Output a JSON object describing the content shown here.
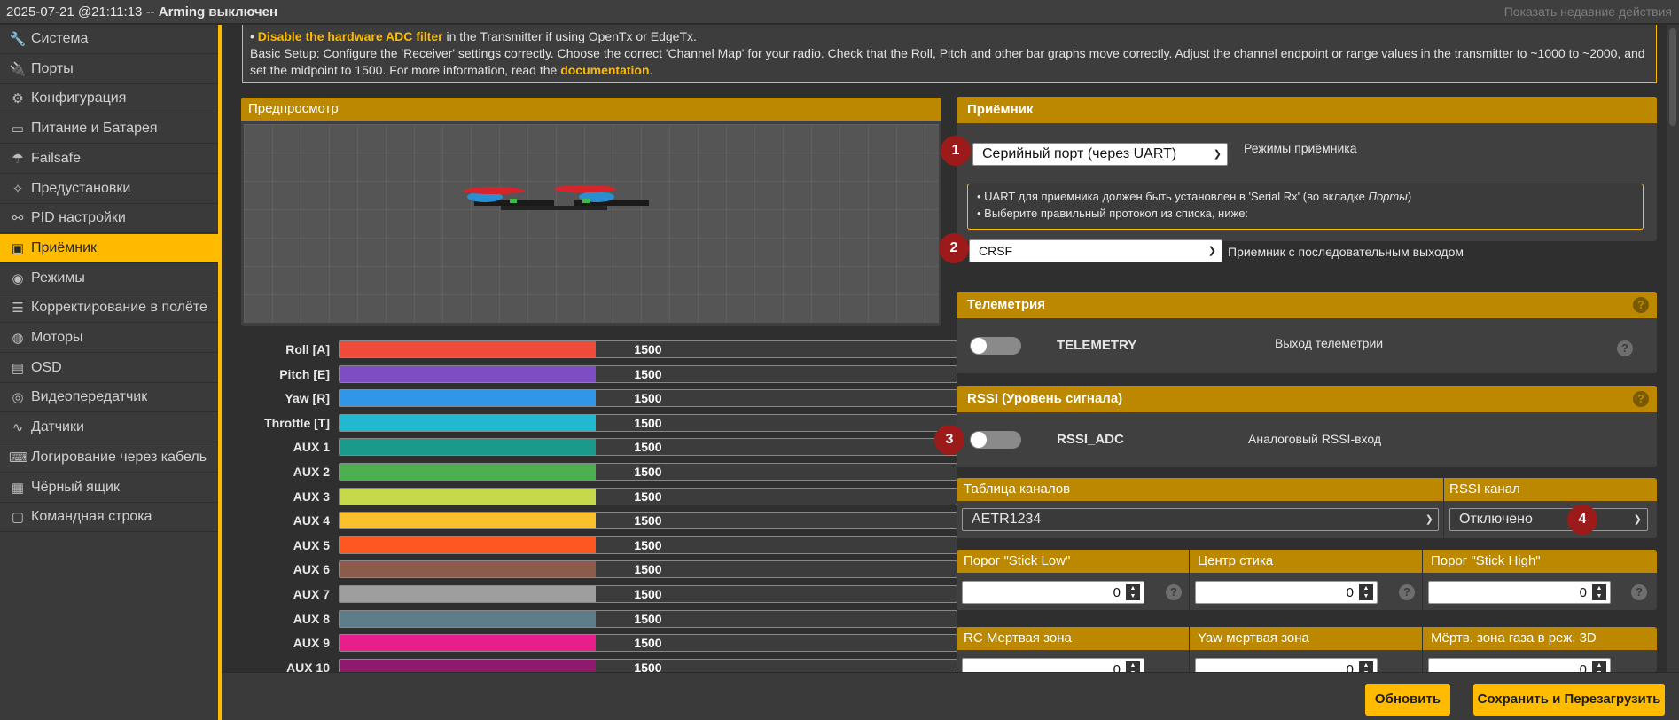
{
  "topbar": {
    "title_prefix": "2025-07-21 @21:11:13 -- ",
    "title_status": "Arming выключен",
    "recent_actions": "Показать недавние действия"
  },
  "sidebar": {
    "items": [
      {
        "label": "Система",
        "icon": "wrench-icon"
      },
      {
        "label": "Порты",
        "icon": "plug-icon"
      },
      {
        "label": "Конфигурация",
        "icon": "gear-icon"
      },
      {
        "label": "Питание и Батарея",
        "icon": "battery-icon"
      },
      {
        "label": "Failsafe",
        "icon": "parachute-icon"
      },
      {
        "label": "Предустановки",
        "icon": "magic-wand-icon"
      },
      {
        "label": "PID настройки",
        "icon": "tree-icon"
      },
      {
        "label": "Приёмник",
        "icon": "robot-icon"
      },
      {
        "label": "Режимы",
        "icon": "toggles-icon"
      },
      {
        "label": "Корректирование в полёте",
        "icon": "sliders-icon"
      },
      {
        "label": "Моторы",
        "icon": "motor-icon"
      },
      {
        "label": "OSD",
        "icon": "osd-icon"
      },
      {
        "label": "Видеопередатчик",
        "icon": "broadcast-icon"
      },
      {
        "label": "Датчики",
        "icon": "pulse-icon"
      },
      {
        "label": "Логирование через кабель",
        "icon": "keyboard-icon"
      },
      {
        "label": "Чёрный ящик",
        "icon": "film-icon"
      },
      {
        "label": "Командная строка",
        "icon": "terminal-icon"
      }
    ],
    "active_index": 7
  },
  "note": {
    "bullet": "• ",
    "hardware_link": "Disable the hardware ADC filter",
    "line1_rest": " in the Transmitter if using OpenTx or EdgeTx.",
    "line2": "Basic Setup: Configure the 'Receiver' settings correctly. Choose the correct 'Channel Map' for your radio. Check that the Roll, Pitch and other bar graphs move correctly. Adjust the channel endpoint or range values in the transmitter to ~1000 to ~2000, and set the midpoint to 1500. For more information, read the ",
    "doc_link": "documentation",
    "line2_end": "."
  },
  "preview": {
    "title": "Предпросмотр"
  },
  "channels": [
    {
      "name": "Roll [A]",
      "value": "1500",
      "color": "#f04a3a"
    },
    {
      "name": "Pitch [E]",
      "value": "1500",
      "color": "#7e4dc4"
    },
    {
      "name": "Yaw [R]",
      "value": "1500",
      "color": "#2f96e8"
    },
    {
      "name": "Throttle [T]",
      "value": "1500",
      "color": "#22b8cf"
    },
    {
      "name": "AUX 1",
      "value": "1500",
      "color": "#1a9a8a"
    },
    {
      "name": "AUX 2",
      "value": "1500",
      "color": "#4caf50"
    },
    {
      "name": "AUX 3",
      "value": "1500",
      "color": "#c5d94a"
    },
    {
      "name": "AUX 4",
      "value": "1500",
      "color": "#fbc02d"
    },
    {
      "name": "AUX 5",
      "value": "1500",
      "color": "#ff5722"
    },
    {
      "name": "AUX 6",
      "value": "1500",
      "color": "#8d5b4c"
    },
    {
      "name": "AUX 7",
      "value": "1500",
      "color": "#9e9e9e"
    },
    {
      "name": "AUX 8",
      "value": "1500",
      "color": "#5e7d8b"
    },
    {
      "name": "AUX 9",
      "value": "1500",
      "color": "#e91e8c"
    },
    {
      "name": "AUX 10",
      "value": "1500",
      "color": "#8e1a6e"
    }
  ],
  "channel_fill_fraction": 0.415,
  "receiver": {
    "title": "Приёмник",
    "mode_value": "Серийный порт (через UART)",
    "mode_label": "Режимы приёмника",
    "info_line1_a": "• UART для приемника должен быть установлен в 'Serial Rx' (во вкладке ",
    "info_line1_italic": "Порты",
    "info_line1_b": ")",
    "info_line2": "• Выберите правильный протокол из списка, ниже:",
    "protocol_value": "CRSF",
    "protocol_label": "Приемник с последовательным выходом",
    "badge1": "1",
    "badge2": "2"
  },
  "telemetry": {
    "title": "Телеметрия",
    "name": "TELEMETRY",
    "desc": "Выход телеметрии",
    "help": "?"
  },
  "rssi": {
    "title": "RSSI (Уровень сигнала)",
    "name": "RSSI_ADC",
    "desc": "Аналоговый RSSI-вход",
    "help": "?",
    "badge3": "3"
  },
  "channel_map": {
    "title": "Таблица каналов",
    "value": "AETR1234",
    "rssi_channel_title": "RSSI канал",
    "rssi_channel_value": "Отключено",
    "badge4": "4"
  },
  "sticks": {
    "low_title": "Порог \"Stick Low\"",
    "center_title": "Центр стика",
    "high_title": "Порог \"Stick High\"",
    "low_value": "0",
    "center_value": "0",
    "high_value": "0",
    "help": "?"
  },
  "deadband": {
    "rc_title": "RC Мертвая зона",
    "yaw_title": "Yaw мертвая зона",
    "throttle3d_title": "Мёртв. зона газа в реж. 3D",
    "rc_value": "0",
    "yaw_value": "0",
    "throttle3d_value": "0"
  },
  "buttons": {
    "refresh": "Обновить",
    "save_reboot": "Сохранить и Перезагрузить"
  }
}
